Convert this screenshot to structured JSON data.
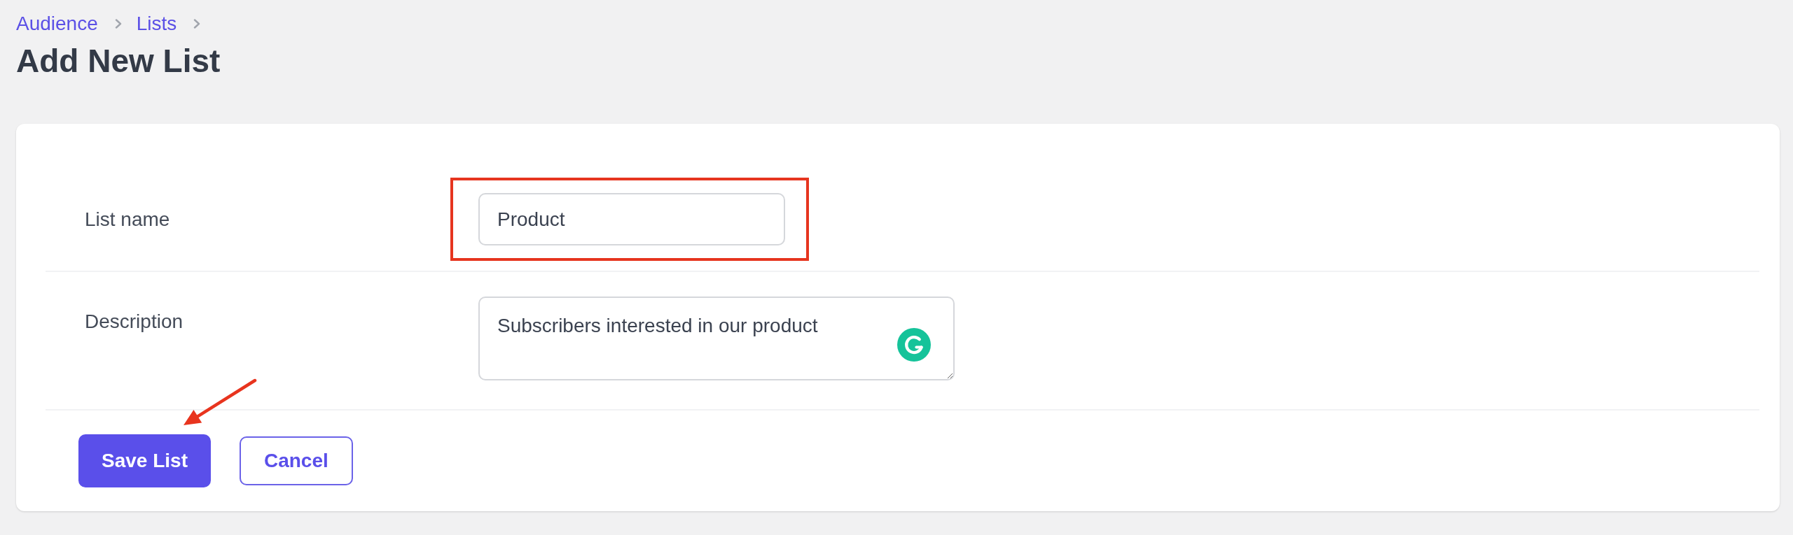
{
  "breadcrumb": [
    {
      "label": "Audience"
    },
    {
      "label": "Lists"
    }
  ],
  "page_title": "Add New List",
  "form": {
    "fields": [
      {
        "kind": "text",
        "label": "List name",
        "value": "Product",
        "highlighted": true,
        "assistant_badge": false
      },
      {
        "kind": "textarea",
        "label": "Description",
        "value": "Subscribers interested in our product",
        "highlighted": false,
        "assistant_badge": true
      }
    ],
    "buttons": [
      {
        "kind": "primary",
        "label": "Save List",
        "arrow": true
      },
      {
        "kind": "secondary",
        "label": "Cancel",
        "arrow": false
      }
    ]
  }
}
